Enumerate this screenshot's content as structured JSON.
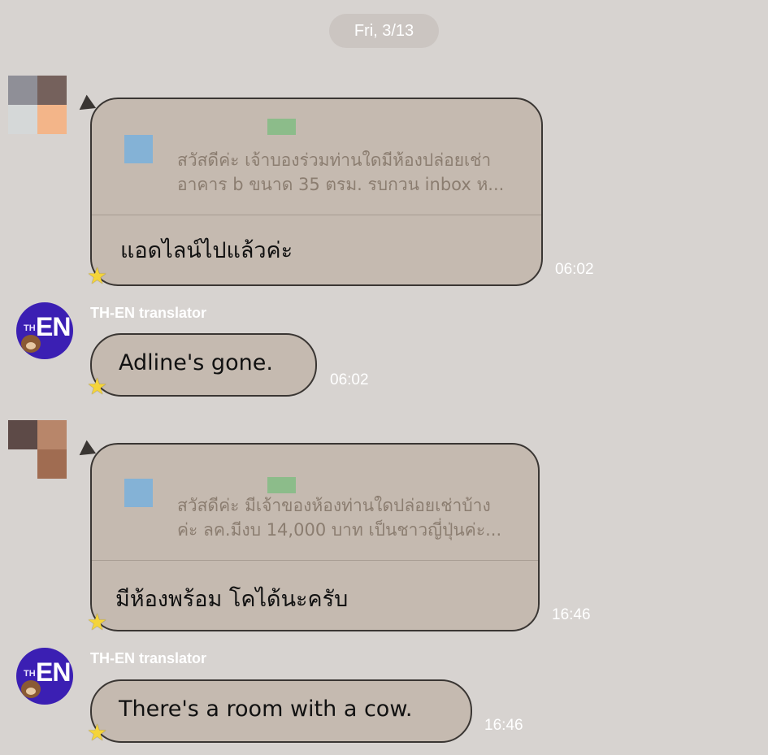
{
  "date_separator": "Fri, 3/13",
  "messages": [
    {
      "quote_line1": "สวัสดีค่ะ เจ้าบองร่วมท่านใดมีห้องปล่อยเช่า",
      "quote_line2": "อาคาร b ขนาด 35 ตรม. รบกวน inbox ห...",
      "text": "แอดไลน์ไปแล้วค่ะ",
      "time": "06:02"
    },
    {
      "sender": "TH-EN translator",
      "text": "Adline's gone.",
      "time": "06:02"
    },
    {
      "quote_line1": "สวัสดีค่ะ มีเจ้าของห้องท่านใดปล่อยเช่าบ้าง",
      "quote_line2": "ค่ะ ลค.มีงบ 14,000 บาท เป็นชาวญี่ปุ่นค่ะ...",
      "text": "มีห้องพร้อม โคได้นะครับ",
      "time": "16:46"
    },
    {
      "sender": "TH-EN translator",
      "text": "There's a room with a cow.",
      "time": "16:46"
    }
  ],
  "bot_avatar": {
    "th": "TH",
    "en": "EN"
  },
  "colors": {
    "background": "#d7d3d0",
    "bubble": "#c5bab0",
    "bubble_border": "#3a3633",
    "bot_avatar": "#3b1fb3",
    "star": "#f4d43a"
  },
  "icons": [
    "star-icon",
    "bear-icon"
  ]
}
